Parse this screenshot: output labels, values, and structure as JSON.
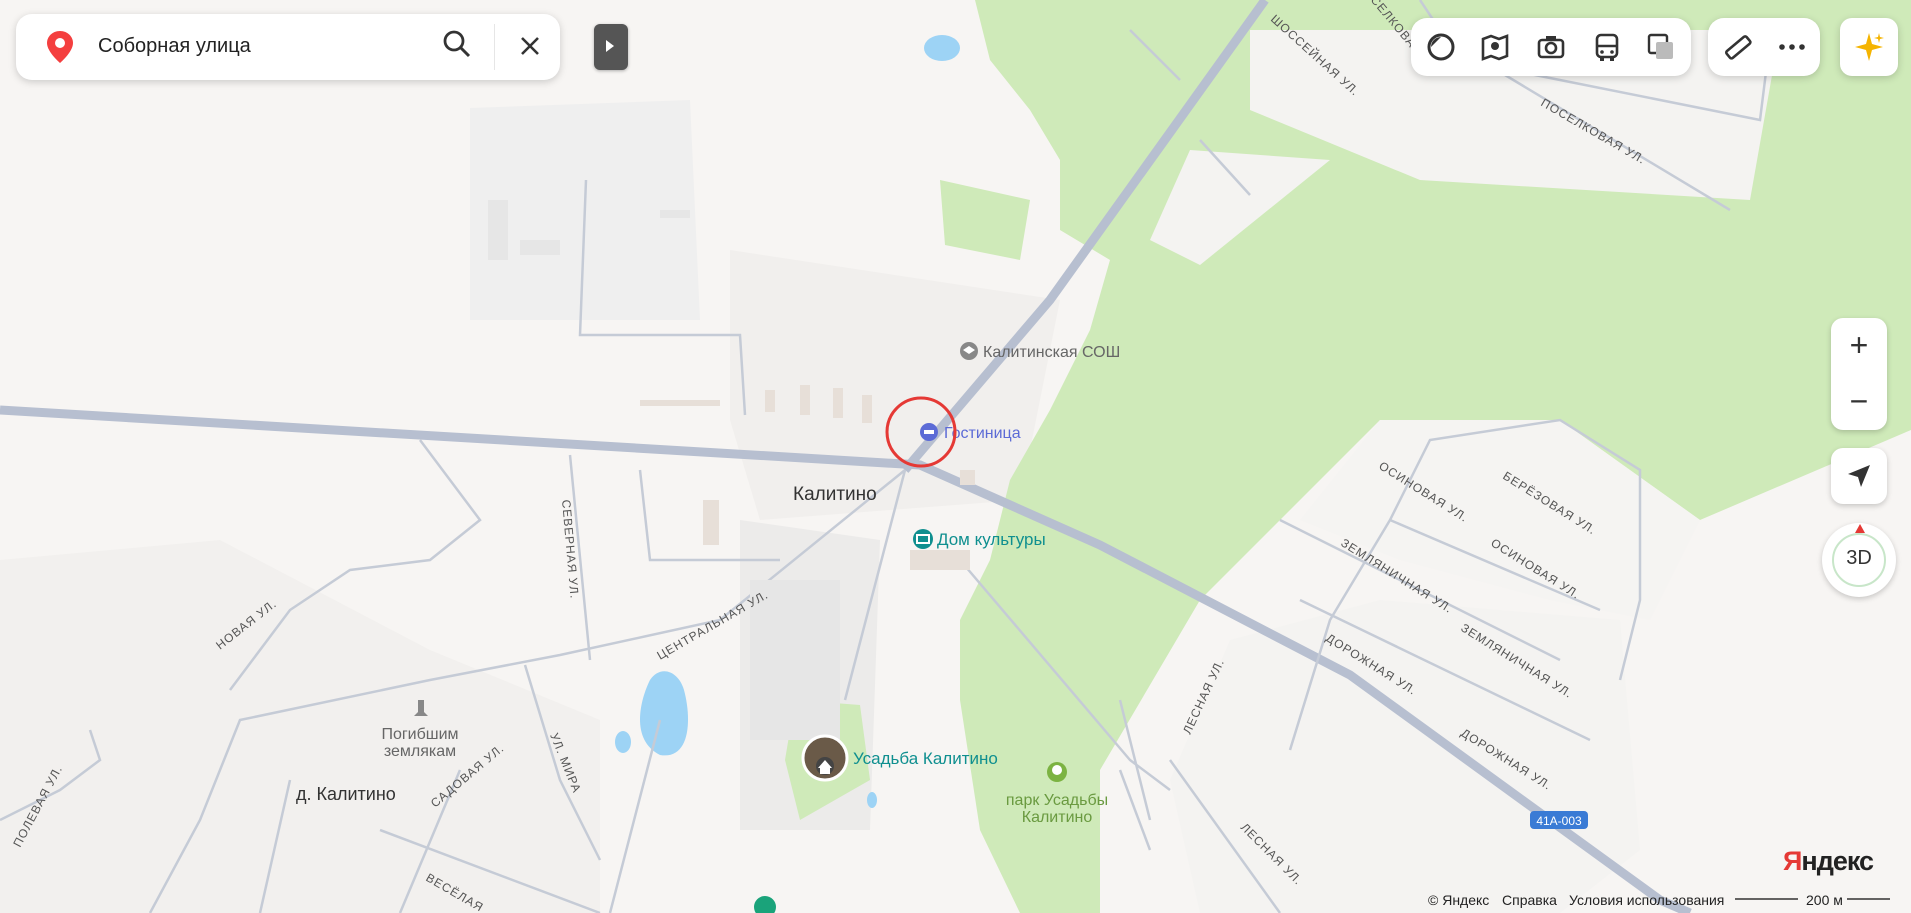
{
  "search": {
    "query": "Соборная улица"
  },
  "map": {
    "places": {
      "village": "Калитино",
      "village2": "д. Калитино",
      "school": "Калитинская СОШ",
      "hotel": "Гостиница",
      "culture": "Дом культуры",
      "estate": "Усадьба Калитино",
      "park_line1": "парк Усадьбы",
      "park_line2": "Калитино",
      "memorial_line1": "Погибшим",
      "memorial_line2": "землякам",
      "road_badge": "41А-003"
    },
    "streets": {
      "shosseynaya": "ШОССЕЙНАЯ УЛ.",
      "selkova": "СЕЛКОВА",
      "poselkovaya": "ПОСЕЛКОВАЯ УЛ.",
      "severnaya": "СЕВЕРНАЯ УЛ.",
      "novaya": "НОВАЯ УЛ.",
      "tsentralnaya": "ЦЕНТРАЛЬНАЯ УЛ.",
      "osinovaya1": "ОСИНОВАЯ УЛ.",
      "osinovaya2": "ОСИНОВАЯ УЛ.",
      "berezovaya": "БЕРЁЗОВАЯ УЛ.",
      "zemlyanichnaya1": "ЗЕМЛЯНИЧНАЯ УЛ.",
      "zemlyanichnaya2": "ЗЕМЛЯНИЧНАЯ УЛ.",
      "dorozhnaya1": "ДОРОЖНАЯ УЛ.",
      "dorozhnaya2": "ДОРОЖНАЯ УЛ.",
      "lesnaya1": "ЛЕСНАЯ УЛ.",
      "lesnaya2": "ЛЕСНАЯ УЛ.",
      "polevaya": "ПОЛЕВАЯ УЛ.",
      "sadovaya": "САДОВАЯ УЛ.",
      "mira": "УЛ. МИРА",
      "veselaya": "ВЕСЁЛАЯ"
    }
  },
  "footer": {
    "copyright": "© Яндекс",
    "help": "Справка",
    "terms": "Условия использования",
    "scale": "200 м"
  },
  "logo": {
    "y": "Я",
    "rest": "ндекс"
  },
  "colors": {
    "forest": "#cfeab9",
    "road": "#b7bfd0",
    "water": "#9dd3f5",
    "hotel": "#5c6bd6",
    "culture": "#0f8f8f",
    "marker": "#e53935"
  }
}
